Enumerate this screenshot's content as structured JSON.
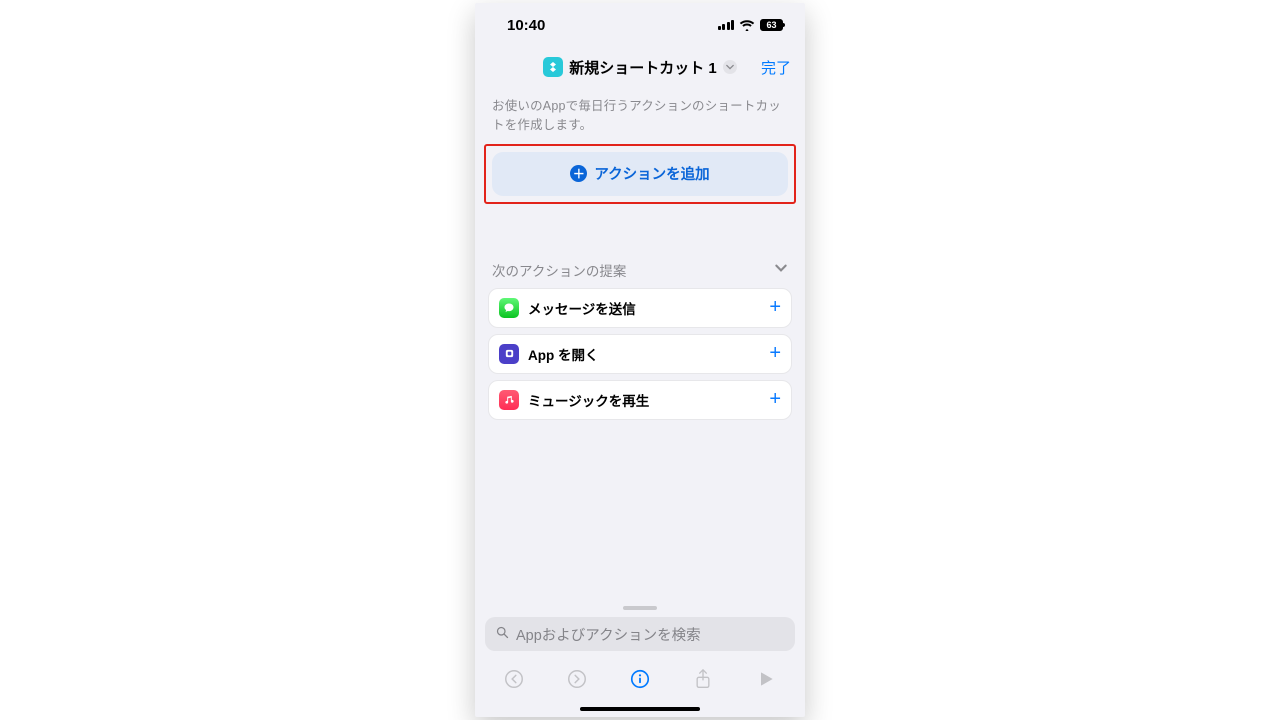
{
  "status": {
    "time": "10:40",
    "battery": "63"
  },
  "nav": {
    "title": "新規ショートカット 1",
    "done": "完了"
  },
  "hint": "お使いのAppで毎日行うアクションのショートカットを作成します。",
  "add_action": "アクションを追加",
  "suggestions": {
    "header": "次のアクションの提案",
    "items": [
      {
        "label": "メッセージを送信"
      },
      {
        "label": "App を開く"
      },
      {
        "label": "ミュージックを再生"
      }
    ]
  },
  "search": {
    "placeholder": "Appおよびアクションを検索"
  }
}
